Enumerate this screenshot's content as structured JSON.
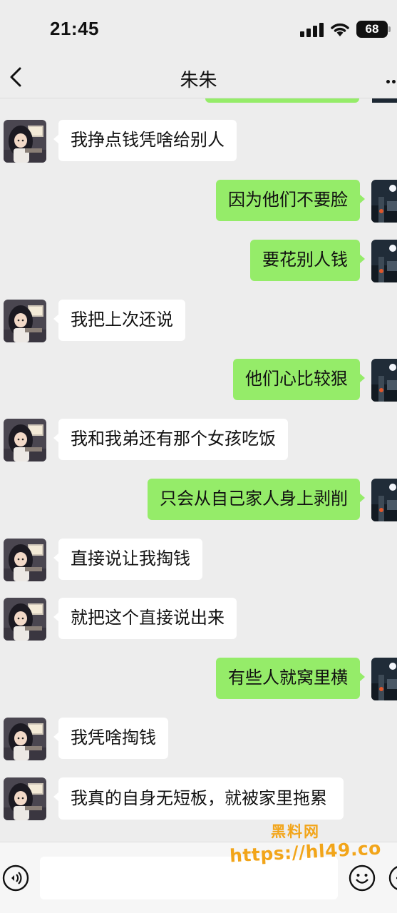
{
  "status_bar": {
    "time": "21:45",
    "battery": "68",
    "icons": [
      "signal-icon",
      "wifi-icon",
      "battery-icon"
    ]
  },
  "nav": {
    "title": "朱朱",
    "icons": [
      "back-arrow-icon",
      "more-options-icon"
    ]
  },
  "messages": [
    {
      "side": "left",
      "text": "我挣点钱凭啥给别人"
    },
    {
      "side": "right",
      "text": "因为他们不要脸"
    },
    {
      "side": "right",
      "text": "要花别人钱"
    },
    {
      "side": "left",
      "text": "我把上次还说"
    },
    {
      "side": "right",
      "text": "他们心比较狠"
    },
    {
      "side": "left",
      "text": "我和我弟还有那个女孩吃饭"
    },
    {
      "side": "right",
      "text": "只会从自己家人身上剥削"
    },
    {
      "side": "left",
      "text": "直接说让我掏钱"
    },
    {
      "side": "left",
      "text": "就把这个直接说出来"
    },
    {
      "side": "right",
      "text": "有些人就窝里横"
    },
    {
      "side": "left",
      "text": "我凭啥掏钱"
    },
    {
      "side": "left",
      "text": "我真的自身无短板，就被家里拖累"
    }
  ],
  "input_bar": {
    "icons": [
      "voice-icon",
      "emoji-icon",
      "plus-icon"
    ]
  },
  "watermark": {
    "title": "黑料网",
    "url": "https://hl49.co"
  },
  "colors": {
    "background": "#ededed",
    "sent_bubble": "#95ec69",
    "received_bubble": "#ffffff",
    "watermark": "#f2a51a"
  }
}
